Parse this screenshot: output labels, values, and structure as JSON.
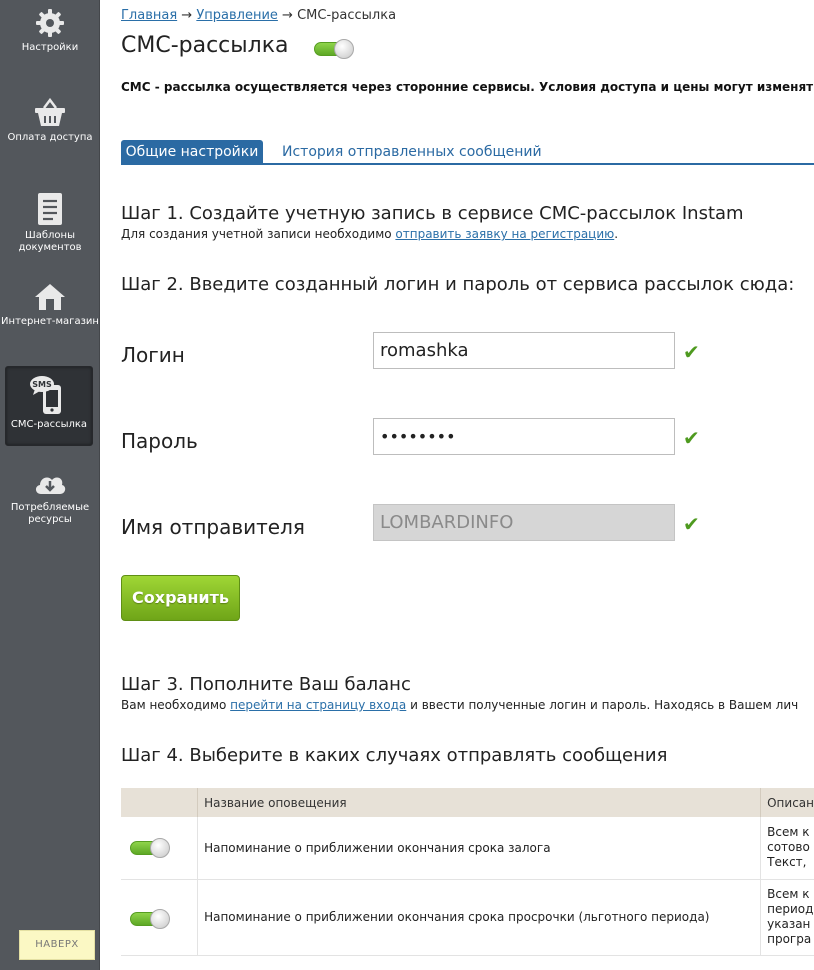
{
  "sidebar": {
    "items": [
      {
        "label": "Настройки",
        "icon": "gear-icon"
      },
      {
        "label": "Оплата доступа",
        "icon": "basket-icon"
      },
      {
        "label": "Шаблоны документов",
        "icon": "document-icon"
      },
      {
        "label": "Интернет-магазин",
        "icon": "home-icon"
      },
      {
        "label": "СМС-рассылка",
        "icon": "sms-phone-icon",
        "active": true
      },
      {
        "label": "Потребляемые ресурсы",
        "icon": "cloud-download-icon"
      }
    ],
    "back_to_top": "НАВЕРХ"
  },
  "breadcrumb": {
    "home": "Главная",
    "sep": "→",
    "manage": "Управление",
    "current": "СМС-рассылка"
  },
  "page": {
    "title": "СМС-рассылка",
    "enabled": true,
    "notice": "СМС - рассылка осуществляется через сторонние сервисы. Условия доступа и цены могут изменяться"
  },
  "tabs": [
    {
      "label": "Общие настройки",
      "active": true
    },
    {
      "label": "История отправленных сообщений",
      "active": false
    }
  ],
  "step1": {
    "title": "Шаг 1. Создайте учетную запись в сервисе СМС-рассылок Instam",
    "text_before": "Для создания учетной записи необходимо ",
    "link": "отправить заявку на регистрацию",
    "text_after": "."
  },
  "step2": {
    "title": "Шаг 2. Введите созданный логин и пароль от сервиса рассылок сюда:",
    "login_label": "Логин",
    "login_value": "romashka",
    "password_label": "Пароль",
    "password_value": "••••••••",
    "sender_label": "Имя отправителя",
    "sender_value": "LOMBARDINFO",
    "check_mark": "✔",
    "save_button": "Сохранить"
  },
  "step3": {
    "title": "Шаг 3. Пополните Ваш баланс",
    "text_before": "Вам необходимо ",
    "link": "перейти на страницу входа",
    "text_after": " и ввести полученные логин и пароль. Находясь в Вашем лич"
  },
  "step4": {
    "title": "Шаг 4. Выберите в каких случаях отправлять сообщения",
    "columns": [
      "",
      "Название оповещения",
      "Описан"
    ],
    "rows": [
      {
        "enabled": true,
        "name": "Напоминание о приближении окончания срока залога",
        "desc": [
          "Всем к",
          "сотово",
          "Текст,"
        ]
      },
      {
        "enabled": true,
        "name": "Напоминание о приближении окончания срока просрочки (льготного периода)",
        "desc": [
          "Всем к",
          "период",
          "указан",
          "програ"
        ]
      }
    ]
  },
  "colors": {
    "sidebar_bg": "#53575c",
    "tab_active": "#2b6aa3",
    "link": "#2a6fa8",
    "save_green": "#7fb821",
    "check_green": "#4e9a1f",
    "table_header": "#e7e1d7"
  }
}
